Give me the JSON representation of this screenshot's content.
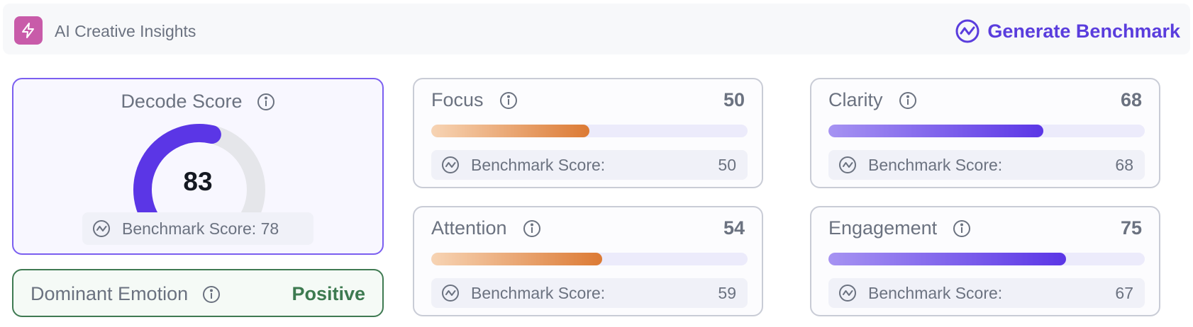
{
  "header": {
    "logo_icon": "lightning-bolt-icon",
    "title": "AI Creative Insights",
    "generate_label": "Generate Benchmark",
    "generate_icon": "trend-circle-icon",
    "accent_color": "#5a3ddd",
    "logo_color": "#c85ba9"
  },
  "decode": {
    "title": "Decode Score",
    "score": "83",
    "score_fraction": 0.83,
    "benchmark_text": "Benchmark Score: 78",
    "info_icon": "info-icon",
    "gauge_color": "#5b36e6"
  },
  "emotion": {
    "label": "Dominant Emotion",
    "value": "Positive",
    "value_color": "#3d7a50"
  },
  "metrics": [
    {
      "title": "Focus",
      "value": "50",
      "fill_fraction": 0.5,
      "benchmark_label": "Benchmark Score:",
      "benchmark_value": "50",
      "color": "orange"
    },
    {
      "title": "Clarity",
      "value": "68",
      "fill_fraction": 0.68,
      "benchmark_label": "Benchmark Score:",
      "benchmark_value": "68",
      "color": "purple"
    },
    {
      "title": "Attention",
      "value": "54",
      "fill_fraction": 0.54,
      "benchmark_label": "Benchmark Score:",
      "benchmark_value": "59",
      "color": "orange"
    },
    {
      "title": "Engagement",
      "value": "75",
      "fill_fraction": 0.75,
      "benchmark_label": "Benchmark Score:",
      "benchmark_value": "67",
      "color": "purple"
    }
  ]
}
